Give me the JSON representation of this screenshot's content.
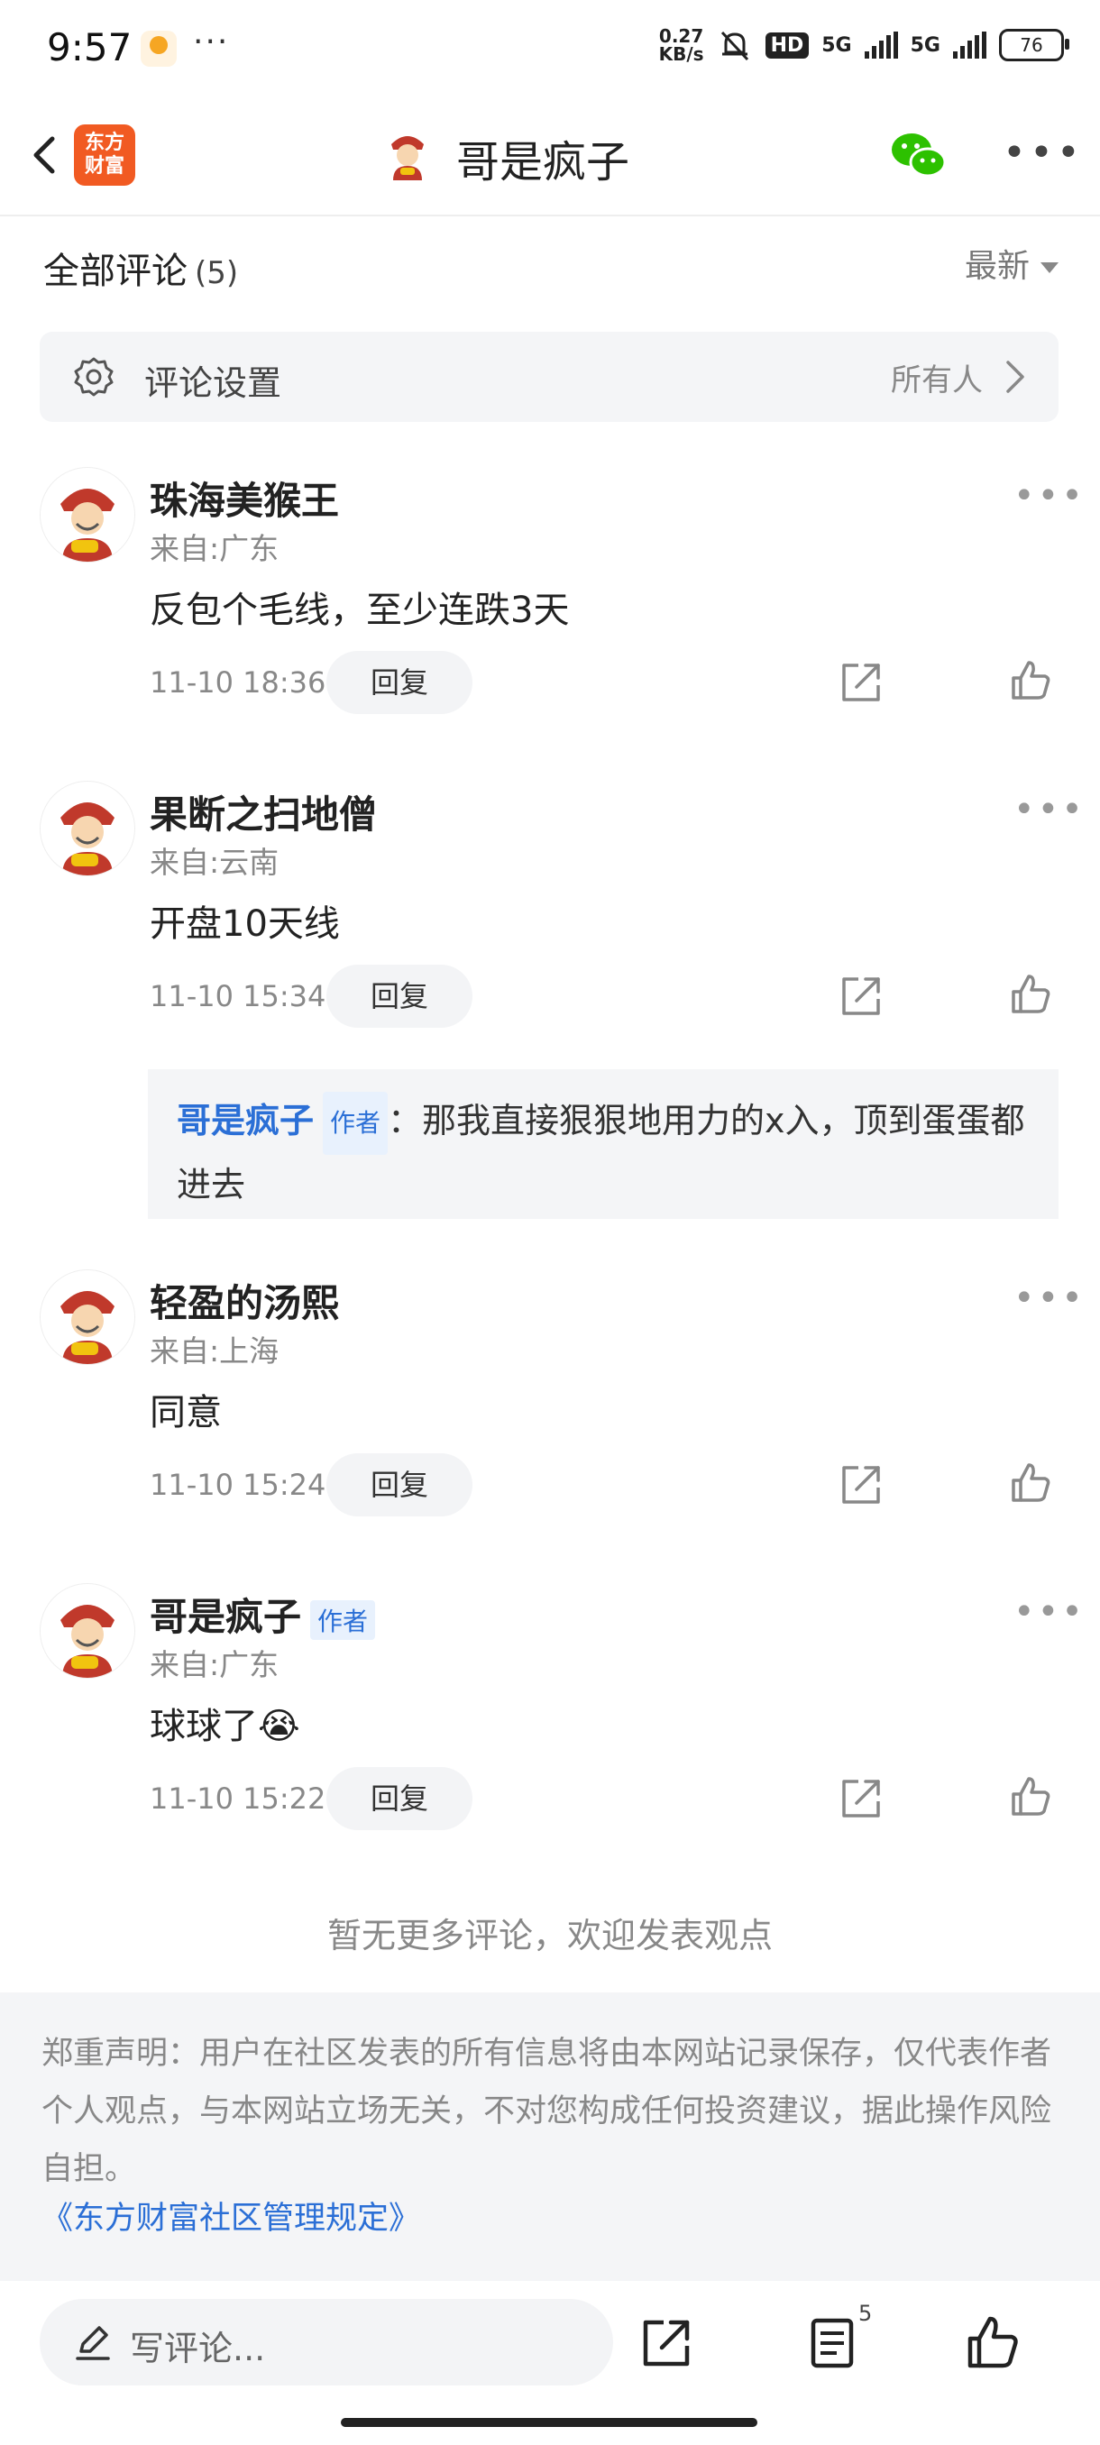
{
  "status_bar": {
    "time": "9:57",
    "dots": "···",
    "net_speed_top": "0.27",
    "net_speed_bottom": "KB/s",
    "hd": "HD",
    "sim1": "5G",
    "sim2": "5G",
    "battery": "76"
  },
  "header": {
    "app_logo_line1": "东方",
    "app_logo_line2": "财富",
    "title": "哥是疯子"
  },
  "comments_header": {
    "title": "全部评论",
    "count": "(5)",
    "sort": "最新"
  },
  "comment_settings": {
    "label": "评论设置",
    "value": "所有人"
  },
  "comments": [
    {
      "name": "珠海美猴王",
      "author": "",
      "location": "来自:广东",
      "content": "反包个毛线，至少连跌3天",
      "time": "11-10 18:36",
      "reply": "回复"
    },
    {
      "name": "果断之扫地僧",
      "author": "",
      "location": "来自:云南",
      "content": "开盘10天线",
      "time": "11-10 15:34",
      "reply": "回复"
    },
    {
      "name": "轻盈的汤熙",
      "author": "",
      "location": "来自:上海",
      "content": "同意",
      "time": "11-10 15:24",
      "reply": "回复"
    },
    {
      "name": "哥是疯子",
      "author": "作者",
      "location": "来自:广东",
      "content": "球球了😭",
      "time": "11-10 15:22",
      "reply": "回复"
    }
  ],
  "nested_reply": {
    "name": "哥是疯子",
    "badge": "作者",
    "text": "：那我直接狠狠地用力的x入，顶到蛋蛋都进去"
  },
  "no_more": "暂无更多评论，欢迎发表观点",
  "disclaimer": {
    "text": "郑重声明：用户在社区发表的所有信息将由本网站记录保存，仅代表作者个人观点，与本网站立场无关，不对您构成任何投资建议，据此操作风险自担。",
    "link": "《东方财富社区管理规定》"
  },
  "bottom_bar": {
    "write_placeholder": "写评论...",
    "list_count": "5"
  }
}
